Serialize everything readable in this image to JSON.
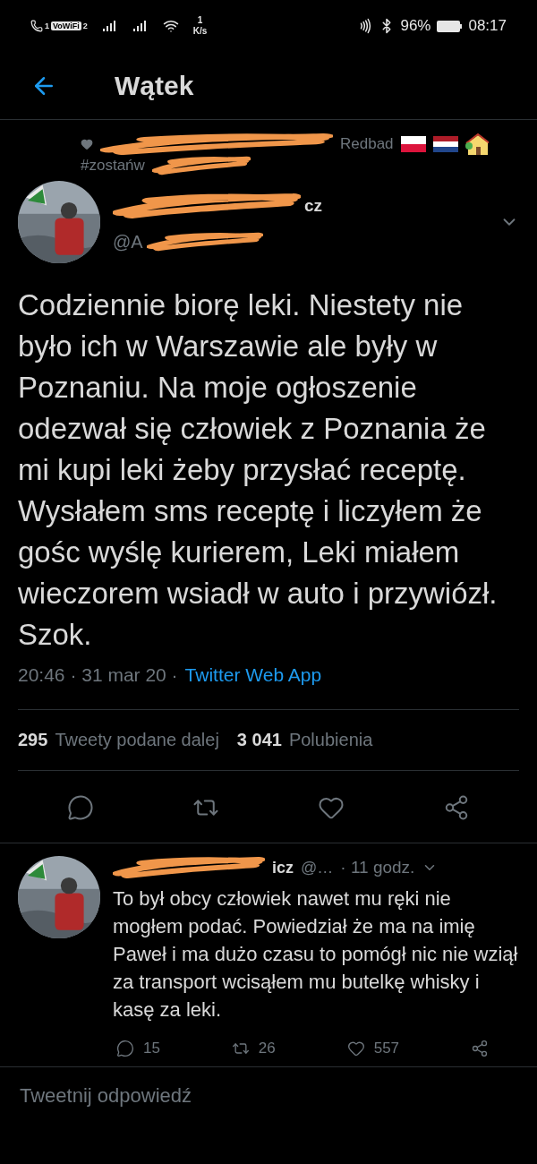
{
  "status_bar": {
    "sim_badge": "1",
    "vowifi": "VoWiFi",
    "vowifi_sim": "2",
    "speed_value": "1",
    "speed_unit": "K/s",
    "battery": "96%",
    "time": "08:17"
  },
  "header": {
    "title": "Wątek"
  },
  "context": {
    "text": "Redbad",
    "hashtag": "#zostańw"
  },
  "author": {
    "name_end": "cz",
    "handle_start": "@A"
  },
  "tweet": {
    "text": "Codziennie biorę leki. Niestety nie było ich w Warszawie ale były w Poznaniu. Na moje ogłoszenie odezwał się człowiek z Poznania że mi kupi leki żeby przysłać receptę. Wysłałem sms receptę i liczyłem że gośc wyślę kurierem, Leki miałem wieczorem wsiadł w auto i przywiózł. Szok.",
    "time": "20:46 · 31 mar 20 ·",
    "source": "Twitter Web App"
  },
  "stats": [
    {
      "count": "295",
      "label": "Tweety podane dalej"
    },
    {
      "count": "3 041",
      "label": "Polubienia"
    }
  ],
  "actions": [
    {
      "kind": "reply"
    },
    {
      "kind": "retweet"
    },
    {
      "kind": "like"
    },
    {
      "kind": "share"
    }
  ],
  "reply": {
    "name_end": "icz",
    "handle": "@…",
    "time": "· 11 godz.",
    "text": "To był obcy człowiek nawet mu ręki nie mogłem podać. Powiedział że ma na imię Paweł i ma dużo czasu to pomógł nic nie wziął za transport wcisąłem mu butelkę whisky i kasę za leki.",
    "actions": [
      {
        "kind": "reply",
        "count": "15"
      },
      {
        "kind": "retweet",
        "count": "26"
      },
      {
        "kind": "like",
        "count": "557"
      },
      {
        "kind": "share"
      }
    ]
  },
  "composer": {
    "placeholder": "Tweetnij odpowiedź"
  }
}
